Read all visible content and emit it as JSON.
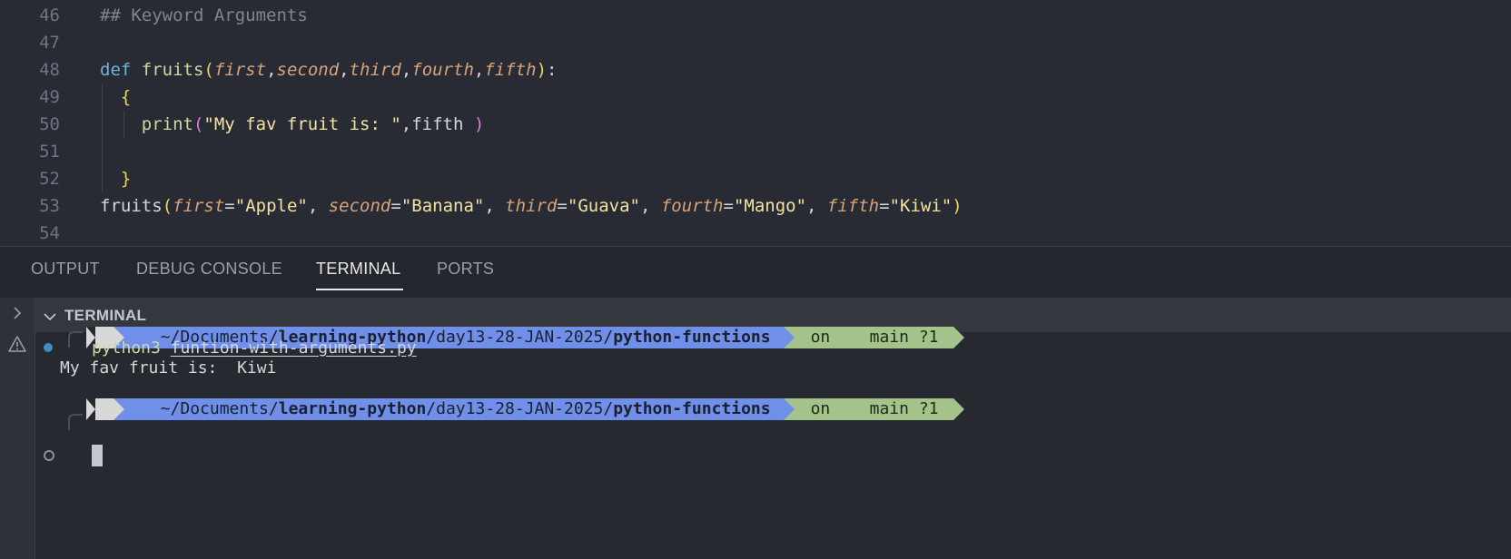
{
  "editor": {
    "lines": [
      {
        "num": "46",
        "tokens": [
          {
            "c": "t-cm",
            "t": "## Keyword Arguments"
          }
        ]
      },
      {
        "num": "47",
        "tokens": []
      },
      {
        "num": "48",
        "tokens": [
          {
            "c": "t-kw",
            "t": "def "
          },
          {
            "c": "t-fn",
            "t": "fruits"
          },
          {
            "c": "t-br1",
            "t": "("
          },
          {
            "c": "t-pr",
            "t": "first"
          },
          {
            "c": "t-df",
            "t": ","
          },
          {
            "c": "t-pr",
            "t": "second"
          },
          {
            "c": "t-df",
            "t": ","
          },
          {
            "c": "t-pr",
            "t": "third"
          },
          {
            "c": "t-df",
            "t": ","
          },
          {
            "c": "t-pr",
            "t": "fourth"
          },
          {
            "c": "t-df",
            "t": ","
          },
          {
            "c": "t-pr",
            "t": "fifth"
          },
          {
            "c": "t-br1",
            "t": ")"
          },
          {
            "c": "t-df",
            "t": ":"
          }
        ]
      },
      {
        "num": "49",
        "tokens": [
          {
            "c": "t-df",
            "t": "  "
          },
          {
            "c": "t-br1",
            "t": "{"
          }
        ]
      },
      {
        "num": "50",
        "tokens": [
          {
            "c": "t-df",
            "t": "    "
          },
          {
            "c": "t-fn",
            "t": "print"
          },
          {
            "c": "t-br2",
            "t": "("
          },
          {
            "c": "t-st",
            "t": "\"My fav fruit is: \""
          },
          {
            "c": "t-df",
            "t": ",fifth "
          },
          {
            "c": "t-br2",
            "t": ")"
          }
        ]
      },
      {
        "num": "51",
        "tokens": []
      },
      {
        "num": "52",
        "tokens": [
          {
            "c": "t-df",
            "t": "  "
          },
          {
            "c": "t-br1",
            "t": "}"
          }
        ]
      },
      {
        "num": "53",
        "tokens": [
          {
            "c": "t-df",
            "t": "fruits"
          },
          {
            "c": "t-br1",
            "t": "("
          },
          {
            "c": "t-pr",
            "t": "first"
          },
          {
            "c": "t-df",
            "t": "="
          },
          {
            "c": "t-st",
            "t": "\"Apple\""
          },
          {
            "c": "t-df",
            "t": ", "
          },
          {
            "c": "t-pr",
            "t": "second"
          },
          {
            "c": "t-df",
            "t": "="
          },
          {
            "c": "t-st",
            "t": "\"Banana\""
          },
          {
            "c": "t-df",
            "t": ", "
          },
          {
            "c": "t-pr",
            "t": "third"
          },
          {
            "c": "t-df",
            "t": "="
          },
          {
            "c": "t-st",
            "t": "\"Guava\""
          },
          {
            "c": "t-df",
            "t": ", "
          },
          {
            "c": "t-pr",
            "t": "fourth"
          },
          {
            "c": "t-df",
            "t": "="
          },
          {
            "c": "t-st",
            "t": "\"Mango\""
          },
          {
            "c": "t-df",
            "t": ", "
          },
          {
            "c": "t-pr",
            "t": "fifth"
          },
          {
            "c": "t-df",
            "t": "="
          },
          {
            "c": "t-st",
            "t": "\"Kiwi\""
          },
          {
            "c": "t-br1",
            "t": ")"
          }
        ]
      },
      {
        "num": "54",
        "tokens": []
      }
    ]
  },
  "panel": {
    "tabs": [
      "OUTPUT",
      "DEBUG CONSOLE",
      "TERMINAL",
      "PORTS"
    ],
    "active_tab": "TERMINAL",
    "section_title": "TERMINAL"
  },
  "terminal": {
    "prompt": {
      "os_icon": "",
      "folder_icon": "",
      "path_prefix": "~/Documents/",
      "path_bold1": "learning-python",
      "path_mid": "/day13-28-JAN-2025/",
      "path_bold2": "python-functions",
      "git_on": "on ",
      "git_icon1": "",
      "git_icon2": "",
      "git_branch": " main ?1"
    },
    "command_bin": "python3",
    "command_arg": "funtion-with-arguments.py",
    "output": "My fav fruit is:  Kiwi"
  },
  "colors": {
    "accent_blue": "#6f8fe8",
    "git_green": "#a3c38a",
    "status_dot": "#3d8fc0"
  }
}
